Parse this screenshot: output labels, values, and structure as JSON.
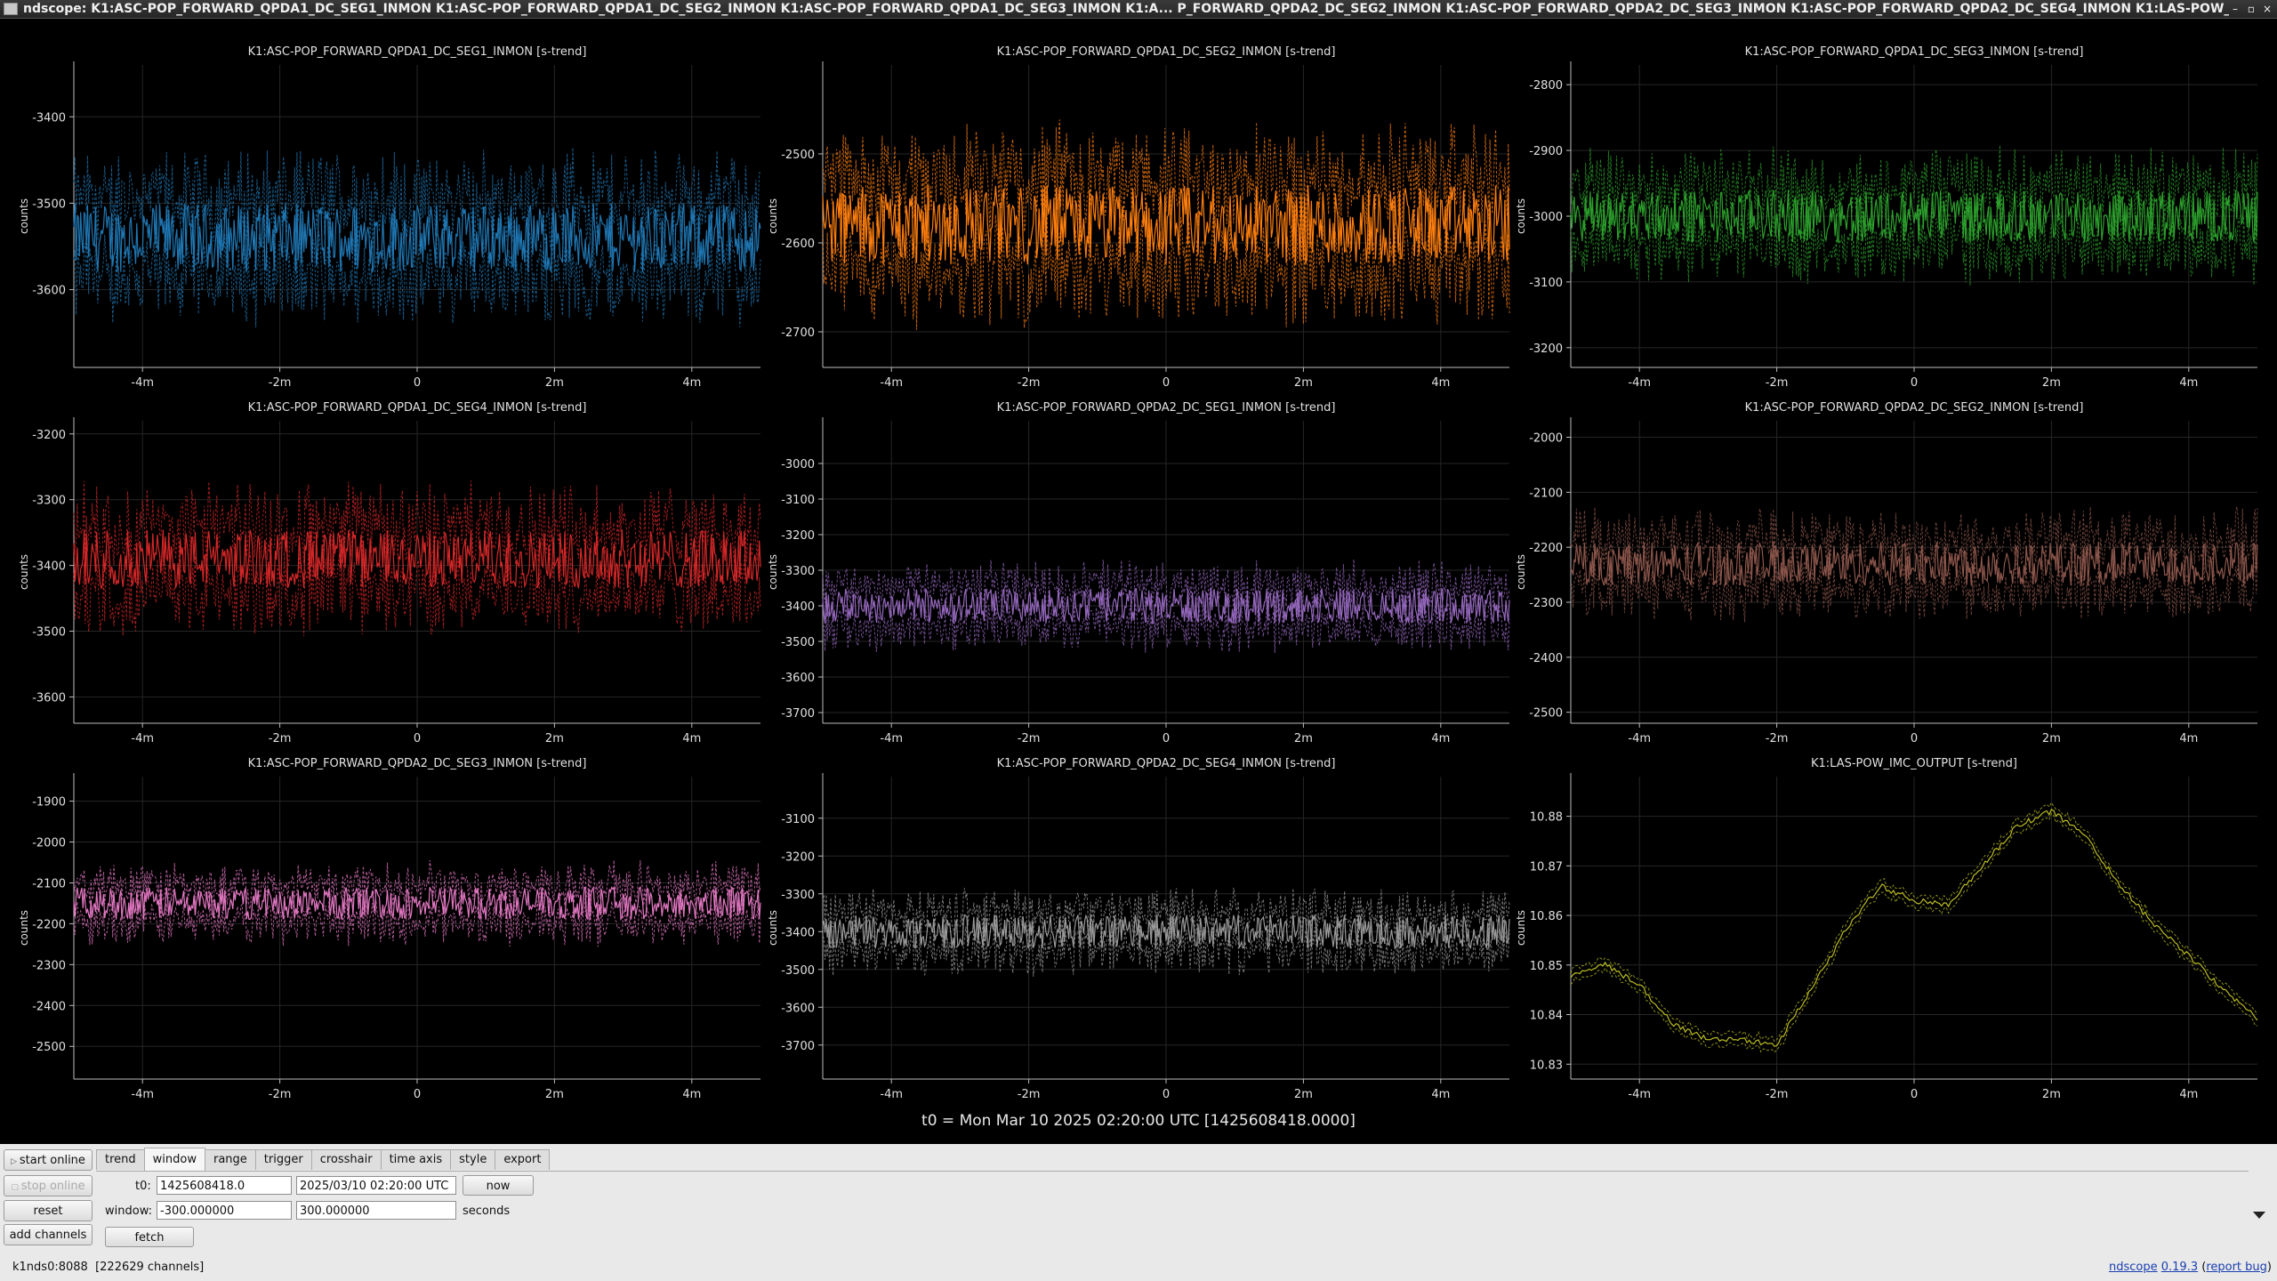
{
  "window": {
    "title": "ndscope: K1:ASC-POP_FORWARD_QPDA1_DC_SEG1_INMON K1:ASC-POP_FORWARD_QPDA1_DC_SEG2_INMON K1:ASC-POP_FORWARD_QPDA1_DC_SEG3_INMON K1:A... P_FORWARD_QPDA2_DC_SEG2_INMON K1:ASC-POP_FORWARD_QPDA2_DC_SEG3_INMON K1:ASC-POP_FORWARD_QPDA2_DC_SEG4_INMON K1:LAS-POW_IMC_OUTPUT"
  },
  "t0_label": "t0 = Mon Mar 10 2025 02:20:00 UTC [1425608418.0000]",
  "chart_data": [
    {
      "type": "line",
      "title": "K1:ASC-POP_FORWARD_QPDA1_DC_SEG1_INMON [s-trend]",
      "ylabel": "counts",
      "color": "#1f77b4",
      "mean": -3540,
      "amp": 40,
      "ylim": [
        -3690,
        -3340
      ],
      "yticks": [
        -3400,
        -3500,
        -3600
      ],
      "xticks": [
        "-4m",
        "-2m",
        "0",
        "2m",
        "4m"
      ],
      "xlim": [
        -300,
        300
      ]
    },
    {
      "type": "line",
      "title": "K1:ASC-POP_FORWARD_QPDA1_DC_SEG2_INMON [s-trend]",
      "ylabel": "counts",
      "color": "#ff7f0e",
      "mean": -2580,
      "amp": 45,
      "ylim": [
        -2740,
        -2400
      ],
      "yticks": [
        -2500,
        -2600,
        -2700
      ],
      "xticks": [
        "-4m",
        "-2m",
        "0",
        "2m",
        "4m"
      ],
      "xlim": [
        -300,
        300
      ]
    },
    {
      "type": "line",
      "title": "K1:ASC-POP_FORWARD_QPDA1_DC_SEG3_INMON [s-trend]",
      "ylabel": "counts",
      "color": "#2ca02c",
      "mean": -3000,
      "amp": 40,
      "ylim": [
        -3230,
        -2770
      ],
      "yticks": [
        -2800,
        -2900,
        -3000,
        -3100,
        -3200
      ],
      "xticks": [
        "-4m",
        "-2m",
        "0",
        "2m",
        "4m"
      ],
      "xlim": [
        -300,
        300
      ]
    },
    {
      "type": "line",
      "title": "K1:ASC-POP_FORWARD_QPDA1_DC_SEG4_INMON [s-trend]",
      "ylabel": "counts",
      "color": "#d62728",
      "mean": -3390,
      "amp": 45,
      "ylim": [
        -3640,
        -3180
      ],
      "yticks": [
        -3200,
        -3300,
        -3400,
        -3500,
        -3600
      ],
      "xticks": [
        "-4m",
        "-2m",
        "0",
        "2m",
        "4m"
      ],
      "xlim": [
        -300,
        300
      ]
    },
    {
      "type": "line",
      "title": "K1:ASC-POP_FORWARD_QPDA2_DC_SEG1_INMON [s-trend]",
      "ylabel": "counts",
      "color": "#9467bd",
      "mean": -3400,
      "amp": 50,
      "ylim": [
        -3730,
        -2880
      ],
      "yticks": [
        -3000,
        -3100,
        -3200,
        -3300,
        -3400,
        -3500,
        -3600,
        -3700
      ],
      "xticks": [
        "-4m",
        "-2m",
        "0",
        "2m",
        "4m"
      ],
      "xlim": [
        -300,
        300
      ]
    },
    {
      "type": "line",
      "title": "K1:ASC-POP_FORWARD_QPDA2_DC_SEG2_INMON [s-trend]",
      "ylabel": "counts",
      "color": "#8c564b",
      "mean": -2230,
      "amp": 40,
      "ylim": [
        -2520,
        -1970
      ],
      "yticks": [
        -2000,
        -2100,
        -2200,
        -2300,
        -2400,
        -2500
      ],
      "xticks": [
        "-4m",
        "-2m",
        "0",
        "2m",
        "4m"
      ],
      "xlim": [
        -300,
        300
      ]
    },
    {
      "type": "line",
      "title": "K1:ASC-POP_FORWARD_QPDA2_DC_SEG3_INMON [s-trend]",
      "ylabel": "counts",
      "color": "#e377c2",
      "mean": -2150,
      "amp": 40,
      "ylim": [
        -2580,
        -1840
      ],
      "yticks": [
        -1900,
        -2000,
        -2100,
        -2200,
        -2300,
        -2400,
        -2500
      ],
      "xticks": [
        "-4m",
        "-2m",
        "0",
        "2m",
        "4m"
      ],
      "xlim": [
        -300,
        300
      ]
    },
    {
      "type": "line",
      "title": "K1:ASC-POP_FORWARD_QPDA2_DC_SEG4_INMON [s-trend]",
      "ylabel": "counts",
      "color": "#9a9a9a",
      "mean": -3400,
      "amp": 45,
      "ylim": [
        -3790,
        -2990
      ],
      "yticks": [
        -3100,
        -3200,
        -3300,
        -3400,
        -3500,
        -3600,
        -3700
      ],
      "xticks": [
        "-4m",
        "-2m",
        "0",
        "2m",
        "4m"
      ],
      "xlim": [
        -300,
        300
      ]
    },
    {
      "type": "line",
      "title": "K1:LAS-POW_IMC_OUTPUT [s-trend]",
      "ylabel": "counts",
      "color": "#bcbd22",
      "smooth": true,
      "ylim": [
        10.827,
        10.888
      ],
      "yticks": [
        10.88,
        10.87,
        10.86,
        10.85,
        10.84,
        10.83
      ],
      "xticks": [
        "-4m",
        "-2m",
        "0",
        "2m",
        "4m"
      ],
      "xlim": [
        -300,
        300
      ],
      "x": [
        -300,
        -270,
        -240,
        -210,
        -180,
        -150,
        -120,
        -90,
        -60,
        -30,
        0,
        30,
        60,
        90,
        120,
        150,
        180,
        210,
        240,
        270,
        300
      ],
      "y": [
        10.848,
        10.85,
        10.846,
        10.838,
        10.835,
        10.835,
        10.834,
        10.845,
        10.857,
        10.866,
        10.863,
        10.862,
        10.87,
        10.878,
        10.881,
        10.876,
        10.866,
        10.858,
        10.852,
        10.845,
        10.839
      ]
    }
  ],
  "controls": {
    "start_online": "start online",
    "stop_online": "stop online",
    "reset": "reset",
    "add_channels": "add channels",
    "tabs": [
      "trend",
      "window",
      "range",
      "trigger",
      "crosshair",
      "time axis",
      "style",
      "export"
    ],
    "active_tab": "window",
    "t0_label": "t0:",
    "t0_gps": "1425608418.0",
    "t0_utc": "2025/03/10 02:20:00 UTC",
    "now": "now",
    "window_label": "window:",
    "window_start": "-300.000000",
    "window_end": "300.000000",
    "seconds": "seconds",
    "fetch": "fetch"
  },
  "status": {
    "server": "k1nds0:8088",
    "channels": "[222629 channels]",
    "app": "ndscope",
    "version": "0.19.3",
    "report": "report bug"
  }
}
